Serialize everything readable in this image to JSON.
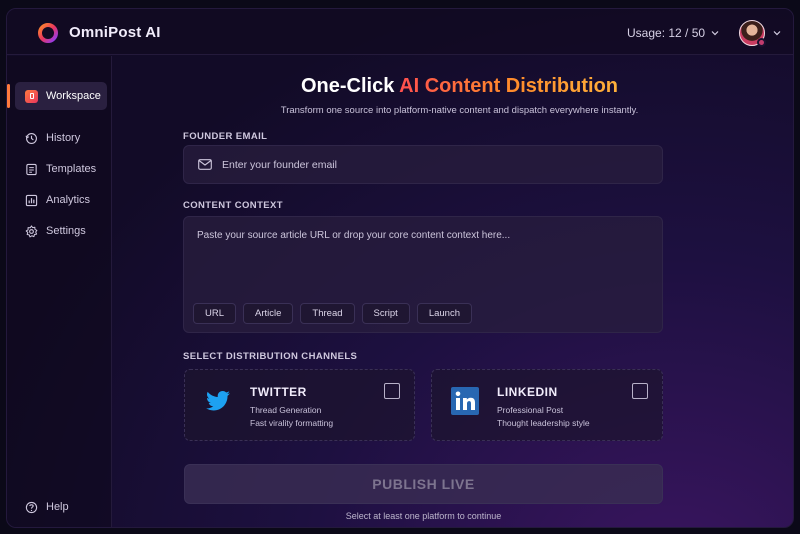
{
  "header": {
    "app_title": "OmniPost AI",
    "usage": "Usage: 12 / 50",
    "logo_icon": "ring-logo-icon",
    "avatar_icon": "user-avatar"
  },
  "sidebar": {
    "items": [
      {
        "label": "Workspace",
        "icon": "workspace-icon",
        "active": true
      },
      {
        "label": "History",
        "icon": "history-icon"
      },
      {
        "label": "Templates",
        "icon": "templates-icon"
      },
      {
        "label": "Analytics",
        "icon": "analytics-icon"
      },
      {
        "label": "Settings",
        "icon": "gear-icon"
      }
    ],
    "help": {
      "label": "Help",
      "icon": "help-icon"
    }
  },
  "main": {
    "title_plain": "One-Click ",
    "title_accent": "AI Content Distribution",
    "subtitle": "Transform one source into platform-native content and dispatch everywhere instantly.",
    "email_label": "FOUNDER EMAIL",
    "email_placeholder": "Enter your founder email",
    "email_value": "",
    "context_label": "CONTENT CONTEXT",
    "context_placeholder": "Paste your source article URL or drop your core content context here...",
    "context_value": "",
    "chips": [
      "URL",
      "Article",
      "Thread",
      "Script",
      "Launch"
    ],
    "channels_label": "SELECT DISTRIBUTION CHANNELS",
    "channels": [
      {
        "name": "TWITTER",
        "line1": "Thread Generation",
        "line2": "Fast virality formatting",
        "checked": false,
        "icon": "twitter-icon"
      },
      {
        "name": "LINKEDIN",
        "line1": "Professional Post",
        "line2": "Thought leadership style",
        "checked": false,
        "icon": "linkedin-icon"
      }
    ],
    "publish_label": "PUBLISH LIVE",
    "hint": "Select at least one platform to continue"
  },
  "colors": {
    "accent_start": "#ff4f4f",
    "accent_end": "#ffb13b",
    "twitter_blue": "#1da1f2",
    "linkedin_blue": "#2867b2",
    "background": "#120b27"
  }
}
